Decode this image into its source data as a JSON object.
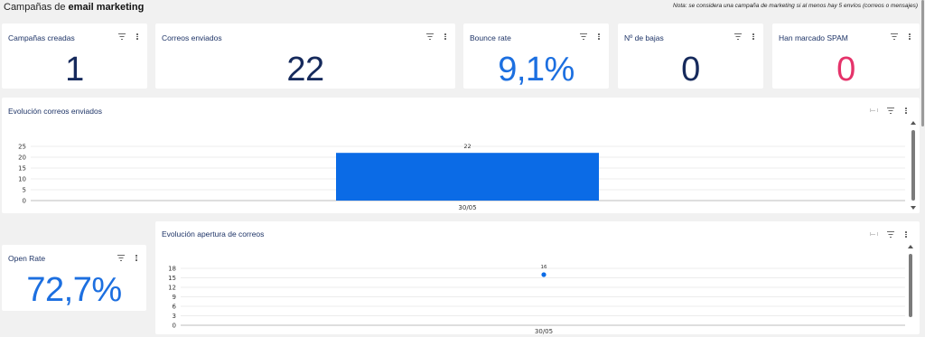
{
  "header": {
    "title_prefix": "Campañas de ",
    "title_bold": "email marketing",
    "note": "Nota: se considera una campaña de marketing si al menos hay 5 envíos (correos o mensajes)"
  },
  "kpis": {
    "campanas": {
      "label": "Campañas creadas",
      "value": "1",
      "color": "#162a5c"
    },
    "correos": {
      "label": "Correos enviados",
      "value": "22",
      "color": "#162a5c"
    },
    "bounce": {
      "label": "Bounce rate",
      "value": "9,1%",
      "color": "#1c6fe0"
    },
    "bajas": {
      "label": "Nº de bajas",
      "value": "0",
      "color": "#162a5c"
    },
    "spam": {
      "label": "Han marcado SPAM",
      "value": "0",
      "color": "#e5336a"
    },
    "open_rate": {
      "label": "Open Rate",
      "value": "72,7%",
      "color": "#1c6fe0"
    }
  },
  "chart_data": [
    {
      "type": "bar",
      "title": "Evolución correos enviados",
      "categories": [
        "30/05"
      ],
      "values": [
        22
      ],
      "data_labels": [
        "22"
      ],
      "ylim": [
        0,
        25
      ],
      "yticks": [
        "0",
        "5",
        "10",
        "15",
        "20",
        "25"
      ],
      "grid": true,
      "color": "#0b6be6"
    },
    {
      "type": "scatter",
      "title": "Evolución apertura de correos",
      "categories": [
        "30/05"
      ],
      "values": [
        16
      ],
      "data_labels": [
        "16"
      ],
      "ylim": [
        0,
        18
      ],
      "yticks": [
        "0",
        "3",
        "6",
        "9",
        "12",
        "15",
        "18"
      ],
      "grid": true,
      "color": "#0b6be6"
    }
  ]
}
